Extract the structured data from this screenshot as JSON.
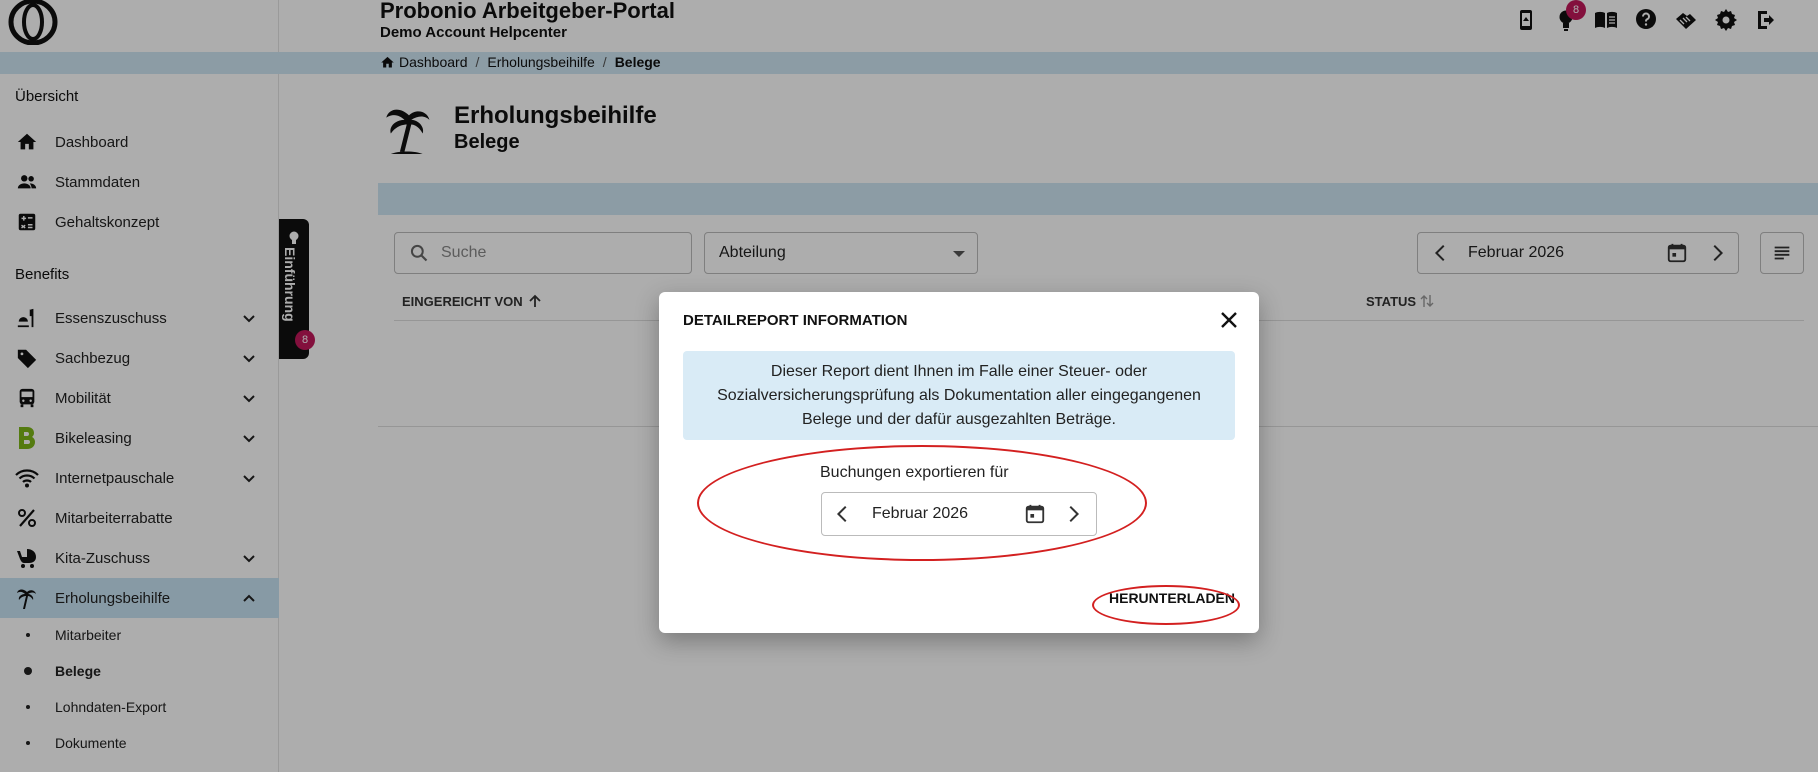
{
  "header": {
    "app_title": "Probonio Arbeitgeber-Portal",
    "app_subtitle": "Demo Account Helpcenter",
    "notifications_count": "8"
  },
  "breadcrumb": {
    "items": [
      "Dashboard",
      "Erholungsbeihilfe",
      "Belege"
    ],
    "separator": "/"
  },
  "sidebar": {
    "section_overview": "Übersicht",
    "overview_items": [
      "Dashboard",
      "Stammdaten",
      "Gehaltskonzept"
    ],
    "section_benefits": "Benefits",
    "benefit_items": [
      "Essenszuschuss",
      "Sachbezug",
      "Mobilität",
      "Bikeleasing",
      "Internetpauschale",
      "Mitarbeiterrabatte",
      "Kita-Zuschuss",
      "Erholungsbeihilfe"
    ],
    "sub_items": [
      "Mitarbeiter",
      "Belege",
      "Lohndaten-Export",
      "Dokumente"
    ]
  },
  "tour": {
    "label": "Einführung",
    "badge": "8"
  },
  "page": {
    "title": "Erholungsbeihilfe",
    "subtitle": "Belege"
  },
  "filters": {
    "search_placeholder": "Suche",
    "department_select": "Abteilung",
    "month": "Februar 2026"
  },
  "table": {
    "col_submitted_by": "EINGEREICHT VON",
    "col_status": "STATUS"
  },
  "modal": {
    "title": "DETAILREPORT INFORMATION",
    "info_line1": "Dieser Report dient Ihnen im Falle einer Steuer- oder",
    "info_line2": "Sozialversicherungsprüfung als Dokumentation aller eingegangenen",
    "info_line3": "Belege und der dafür ausgezahlten Beträge.",
    "export_label": "Buchungen exportieren für",
    "month": "Februar 2026",
    "download_label": "HERUNTERLADEN"
  },
  "colors": {
    "accent_light": "#cfe6f4",
    "badge": "#c2185b",
    "highlight_ring": "#d32020"
  }
}
